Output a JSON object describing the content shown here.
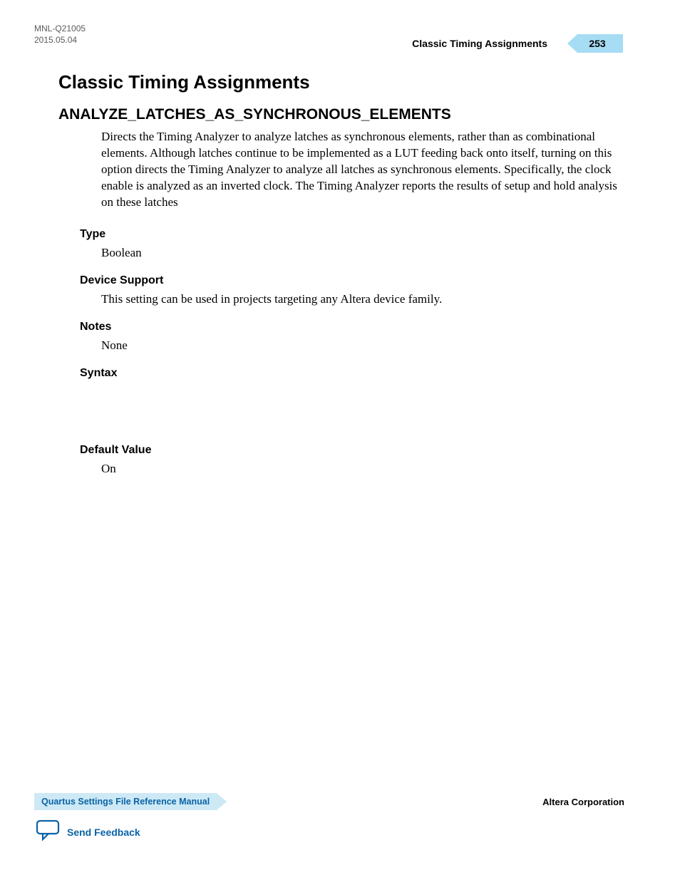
{
  "header": {
    "doc_id": "MNL-Q21005",
    "date": "2015.05.04",
    "breadcrumb": "Classic Timing Assignments",
    "page_number": "253"
  },
  "section": {
    "title": "Classic Timing Assignments",
    "subsection": "ANALYZE_LATCHES_AS_SYNCHRONOUS_ELEMENTS",
    "description": "Directs the Timing Analyzer to analyze latches as synchronous elements, rather than as combinational elements. Although latches continue to be implemented as a LUT feeding back onto itself, turning on this option directs the Timing Analyzer to analyze all latches as synchronous elements. Specifically, the clock enable is analyzed as an inverted clock. The Timing Analyzer reports the results of setup and hold analysis on these latches",
    "fields": {
      "type_label": "Type",
      "type_value": "Boolean",
      "device_support_label": "Device Support",
      "device_support_value": "This setting can be used in projects targeting any Altera device family.",
      "notes_label": "Notes",
      "notes_value": "None",
      "syntax_label": "Syntax",
      "default_value_label": "Default Value",
      "default_value_value": "On"
    }
  },
  "footer": {
    "manual_title": "Quartus Settings File Reference Manual",
    "company": "Altera Corporation",
    "feedback_label": "Send Feedback"
  }
}
